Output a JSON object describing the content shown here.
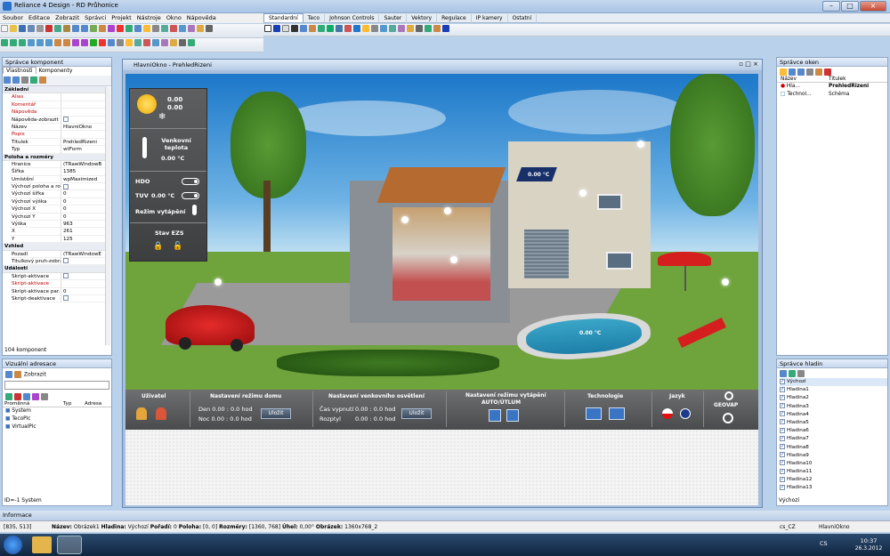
{
  "window": {
    "title": "Reliance 4 Design - RD Průhonice"
  },
  "menu": [
    "Soubor",
    "Editace",
    "Zobrazit",
    "Správci",
    "Projekt",
    "Nástroje",
    "Okno",
    "Nápověda"
  ],
  "component_tabs": [
    "Standardní",
    "Teco",
    "Johnson Controls",
    "Sauter",
    "Vektory",
    "Regulace",
    "IP kamery",
    "Ostatní"
  ],
  "left_panel": {
    "title": "Správce komponent",
    "tabs": [
      "Vlastnosti",
      "Komponenty"
    ],
    "properties": [
      {
        "section": "Základní"
      },
      {
        "k": "Alias",
        "v": "",
        "c": "red"
      },
      {
        "k": "Komentář",
        "v": "",
        "c": "red"
      },
      {
        "k": "Nápověda",
        "v": "",
        "c": "red"
      },
      {
        "k": "Nápověda-zobrazit",
        "v": "",
        "chk": true
      },
      {
        "k": "Název",
        "v": "HlavniOkno"
      },
      {
        "k": "Popis",
        "v": "",
        "c": "red"
      },
      {
        "k": "Titulek",
        "v": "PrehledRizeni"
      },
      {
        "k": "Typ",
        "v": "wtForm"
      },
      {
        "section": "Poloha a rozměry"
      },
      {
        "k": "Hranice",
        "v": "(TRawWindowB"
      },
      {
        "k": "Šířka",
        "v": "1385"
      },
      {
        "k": "Umístění",
        "v": "wpMaximized"
      },
      {
        "k": "Výchozí poloha a rozm",
        "v": "",
        "chk": true
      },
      {
        "k": "Výchozí šířka",
        "v": "0"
      },
      {
        "k": "Výchozí výška",
        "v": "0"
      },
      {
        "k": "Výchozí X",
        "v": "0"
      },
      {
        "k": "Výchozí Y",
        "v": "0"
      },
      {
        "k": "Výška",
        "v": "963"
      },
      {
        "k": "X",
        "v": "261"
      },
      {
        "k": "Y",
        "v": "125"
      },
      {
        "section": "Vzhled"
      },
      {
        "k": "Pozadí",
        "v": "(TRawWindowE"
      },
      {
        "k": "Titulkový pruh-zobrazit",
        "v": "",
        "chk": true
      },
      {
        "section": "Události"
      },
      {
        "k": "Skript-aktivace",
        "v": "",
        "chk": true
      },
      {
        "k": "Skript-aktivace",
        "v": "",
        "c": "red"
      },
      {
        "k": "Skript-aktivace par.",
        "v": "0"
      },
      {
        "k": "Skript-deaktivace",
        "v": "",
        "chk": true
      }
    ],
    "count": "104 komponent"
  },
  "var_panel": {
    "title": "Vizuální adresace",
    "view_label": "Zobrazit",
    "columns": [
      "Proměnná",
      "Typ",
      "Adresa"
    ],
    "items": [
      "System",
      "TecoPlc",
      "VirtualPlc"
    ],
    "status": "ID=-1   System"
  },
  "canvas": {
    "title": "HlavniOkno - PrehledRizeni",
    "sun_values": [
      "0.00",
      "0.00"
    ],
    "outdoor_label": "Venkovní teplota",
    "outdoor_value": "0.00 °C",
    "hdo": "HDO",
    "tuv": "TUV",
    "tuv_value": "0.00 °C",
    "heating_mode": "Režim vytápění",
    "ezs": "Stav EZS",
    "roof_temp": "0.00 °C",
    "pool_temp": "0.00 °C",
    "bottom": {
      "user": "Uživatel",
      "house_mode": "Nastavení režimu domu",
      "day": "Den 0.00 : 0.0 hod",
      "night": "Noc 0.00 : 0.0 hod",
      "save": "Uložit",
      "lighting": "Nastavení venkovního osvětlení",
      "off_time": "Čas vypnutí",
      "off_val": "0.00 : 0.0 hod",
      "range": "Rozptyl",
      "range_val": "0.00 : 0.0 hod",
      "save2": "Uložit",
      "heating": "Nastavení režimu vytápění",
      "heating_sub": "AUTO/ÚTLUM",
      "tech": "Technologie",
      "lang": "Jazyk",
      "brand": "GEOVAP"
    }
  },
  "right_top": {
    "title": "Správce oken",
    "columns": [
      "Název",
      "Titulek"
    ],
    "rows": [
      {
        "name": "Hla...",
        "title": "PrehledRizeni"
      },
      {
        "name": "Technol...",
        "title": "Schéma"
      }
    ]
  },
  "right_bottom": {
    "title": "Správce hladin",
    "layers": [
      "Výchozí",
      "Hladina1",
      "Hladina2",
      "Hladina3",
      "Hladina4",
      "Hladina5",
      "Hladina6",
      "Hladina7",
      "Hladina8",
      "Hladina9",
      "Hladina10",
      "Hladina11",
      "Hladina12",
      "Hladina13"
    ],
    "status": "Výchozí"
  },
  "info": "Informace",
  "status": {
    "coords": "[835, 513]",
    "name_label": "Název:",
    "name": "Obrázek1",
    "layer_label": "Hladina:",
    "layer": "Výchozí",
    "order_label": "Pořadí:",
    "order": "0",
    "pos_label": "Poloha:",
    "pos": "[0, 0]",
    "size_label": "Rozměry:",
    "size": "[1360, 768]",
    "angle_label": "Úhel:",
    "angle": "0,00°",
    "image_label": "Obrázek:",
    "image": "1360x768_2",
    "locale": "cs_CZ",
    "window": "HlavniOkno"
  },
  "taskbar": {
    "lang": "CS",
    "time": "10:37",
    "date": "26.3.2012"
  },
  "colors": {
    "sky": "#3b93d8",
    "grass": "#5d9231",
    "panel_dark": "#4a4b4d",
    "accent": "#2a6fc9"
  }
}
